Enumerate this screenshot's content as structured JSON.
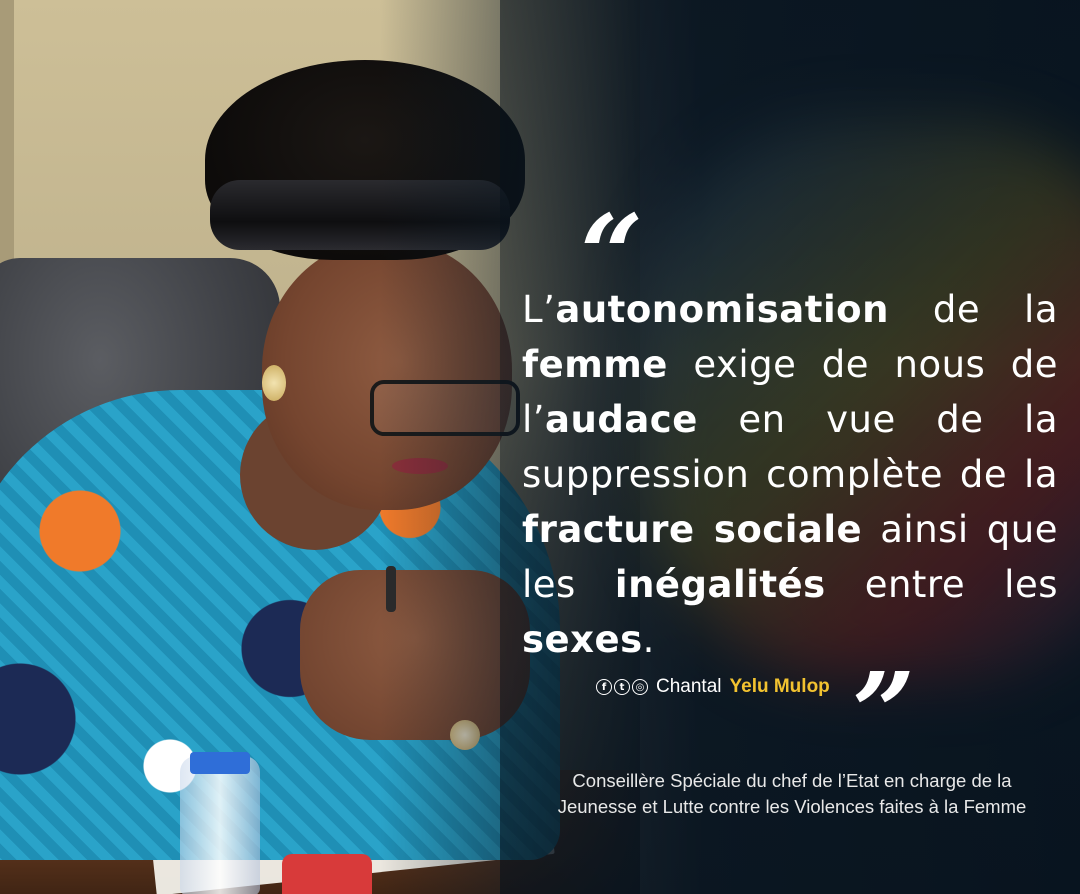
{
  "quote": {
    "open_mark": "“",
    "close_mark": "”",
    "segments": [
      {
        "text": "L’",
        "bold": false
      },
      {
        "text": "autonomisation",
        "bold": true
      },
      {
        "text": " de la ",
        "bold": false
      },
      {
        "text": "femme",
        "bold": true
      },
      {
        "text": " exige de nous de l’",
        "bold": false
      },
      {
        "text": "audace",
        "bold": true
      },
      {
        "text": " en vue de la suppression complète de la ",
        "bold": false
      },
      {
        "text": "fracture sociale",
        "bold": true
      },
      {
        "text": " ainsi que les ",
        "bold": false
      },
      {
        "text": "inégalités",
        "bold": true
      },
      {
        "text": " entre les ",
        "bold": false
      },
      {
        "text": "sexes",
        "bold": true
      },
      {
        "text": ".",
        "bold": false
      }
    ]
  },
  "author": {
    "social_icons": [
      "facebook-icon",
      "twitter-icon",
      "instagram-icon"
    ],
    "first_name": "Chantal",
    "last_name": "Yelu Mulop",
    "name_accent_color": "#f2c230"
  },
  "caption": {
    "line1": "Conseillère Spéciale du chef de l’Etat en charge de la",
    "line2": "Jeunesse et Lutte contre les Violences faites à la Femme"
  }
}
